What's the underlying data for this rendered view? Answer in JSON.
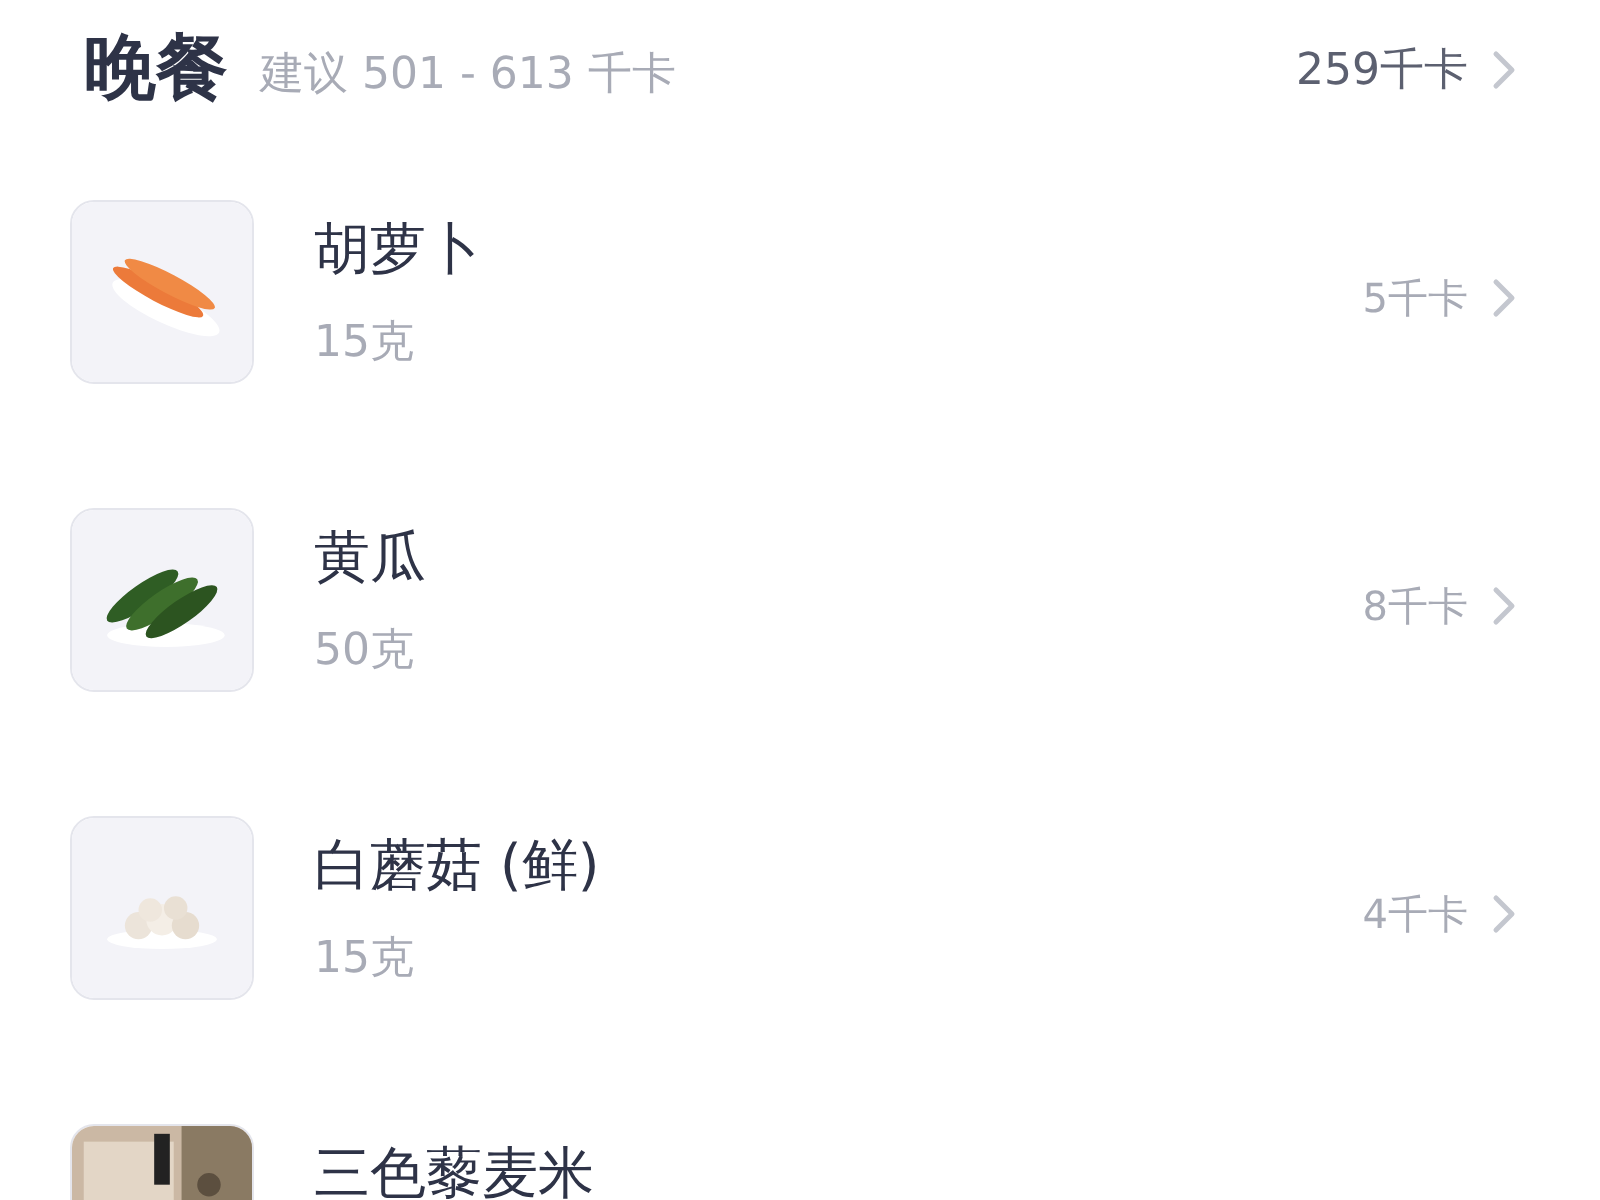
{
  "meal": {
    "title": "晚餐",
    "suggestion": "建议 501 - 613 千卡",
    "total": "259千卡"
  },
  "items": [
    {
      "name": "胡萝卜",
      "amount": "15克",
      "calories": "5千卡"
    },
    {
      "name": "黄瓜",
      "amount": "50克",
      "calories": "8千卡"
    },
    {
      "name": "白蘑菇 (鲜)",
      "amount": "15克",
      "calories": "4千卡"
    },
    {
      "name": "三色藜麦米"
    }
  ]
}
